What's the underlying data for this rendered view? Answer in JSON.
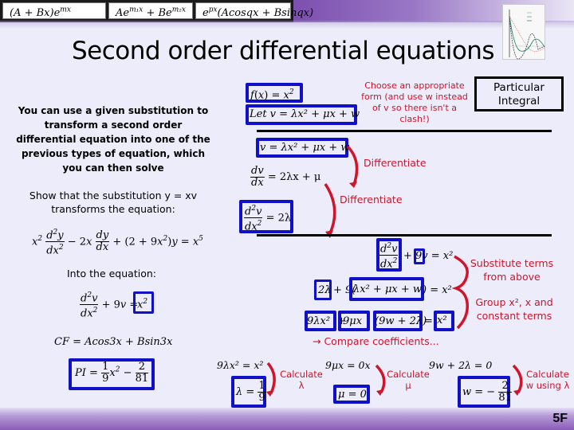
{
  "top_formulas": [
    "(A + Bx)e^mx",
    "Ae^m₁x + Be^m₂x",
    "e^px(Acosqx + Bsinqx)"
  ],
  "title": "Second order differential equations",
  "intro_text": "You can use a given substitution to transform a second order differential equation into one of the previous types of equation, which you can then solve",
  "show_text": "Show that the substitution y = xv transforms the equation:",
  "original_equation": "x² d²y/dx² − 2x dy/dx + (2 + 9x²)y = x⁵",
  "into_text": "Into the equation:",
  "target_equation": "d²v/dx² + 9v = x²",
  "cf": "CF = Acos3x + Bsin3x",
  "pi_result": "PI = 1/9 x² − 2/81",
  "pi_label": "Particular Integral",
  "fx": "f(x) = x²",
  "let_v": "Let v = λx² + μx + w",
  "choose_note": "Choose an appropriate form (and use w instead of v so there isn't a clash!)",
  "diff_steps": {
    "v": "v = λx² + μx + w",
    "dv": "= 2λx + μ",
    "d2v": "= 2λ",
    "label1": "Differentiate",
    "label2": "Differentiate"
  },
  "substitution": {
    "line1_rest": "+ 9v = x²",
    "line2_a": "2λ",
    "line2_op": "+ 9(",
    "line2_b": "λx² + μx + w",
    "line2_rest": ") = x²",
    "line3_a": "9λx²",
    "line3_b": "9μx",
    "line3_c": "(9w + 2λ)",
    "line3_d": "x²",
    "plus": "+",
    "eq": "=",
    "note1": "Substitute terms from above",
    "note2": "Group x², x and constant terms",
    "compare": "→ Compare coefficients..."
  },
  "coefficients": {
    "lambda_eq": "9λx² = x²",
    "lambda_result": "λ =",
    "lambda_num": "1",
    "lambda_den": "9",
    "lambda_note": "Calculate λ",
    "mu_eq": "9μx = 0x",
    "mu_result": "μ = 0",
    "mu_note": "Calculate μ",
    "w_eq": "9w + 2λ = 0",
    "w_result": "w = −",
    "w_num": "2",
    "w_den": "81",
    "w_note": "Calculate w using λ"
  },
  "slide_number": "5F",
  "colors": {
    "box_blue": "#1010c8",
    "note_red": "#d0142a",
    "background": "#ececfa",
    "bar_purple": "#8a5cb8"
  }
}
